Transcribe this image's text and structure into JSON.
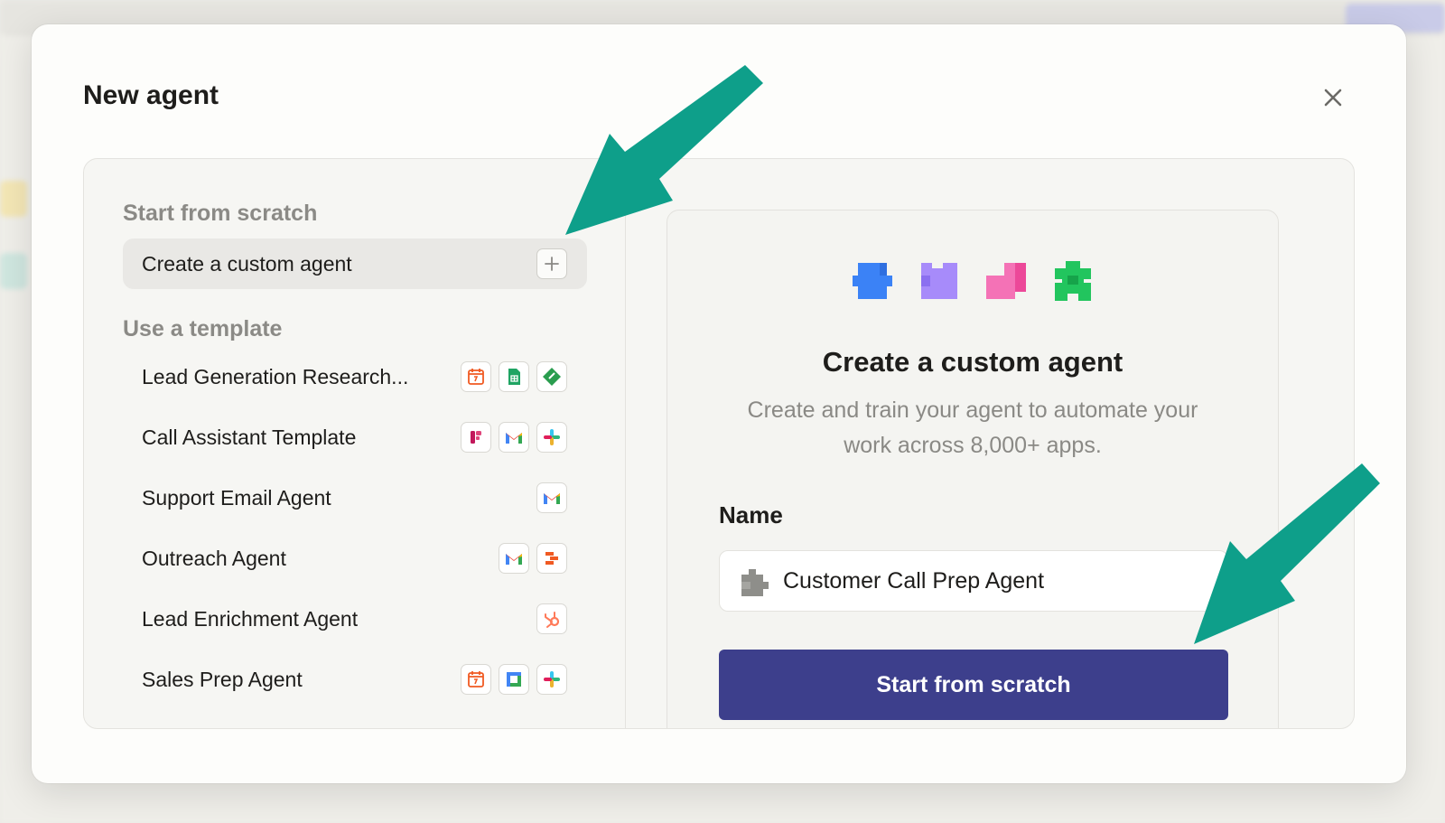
{
  "modal": {
    "title": "New agent"
  },
  "left": {
    "scratch_heading": "Start from scratch",
    "custom_agent_label": "Create a custom agent",
    "template_heading": "Use a template",
    "templates": [
      {
        "label": "Lead Generation Research...",
        "icons": [
          "calendar-icon",
          "google-sheets-icon",
          "diamond-app-icon"
        ]
      },
      {
        "label": "Call Assistant Template",
        "icons": [
          "fathom-icon",
          "gmail-icon",
          "slack-icon"
        ]
      },
      {
        "label": "Support Email Agent",
        "icons": [
          "gmail-icon"
        ]
      },
      {
        "label": "Outreach Agent",
        "icons": [
          "gmail-icon",
          "zapier-icon"
        ]
      },
      {
        "label": "Lead Enrichment Agent",
        "icons": [
          "hubspot-icon"
        ]
      },
      {
        "label": "Sales Prep Agent",
        "icons": [
          "calendar-icon",
          "google-meet-icon",
          "slack-icon"
        ]
      }
    ]
  },
  "card": {
    "title": "Create a custom agent",
    "description": "Create and train your agent to automate your work across 8,000+ apps.",
    "name_label": "Name",
    "name_value": "Customer Call Prep Agent",
    "start_button": "Start from scratch"
  },
  "colors": {
    "primary_button": "#3d3f8c",
    "annotation_arrow": "#0e9f8a",
    "puzzle_blue": "#3b82f6",
    "puzzle_purple": "#a78bfa",
    "puzzle_pink": "#f472b6",
    "puzzle_green": "#22c55e"
  }
}
